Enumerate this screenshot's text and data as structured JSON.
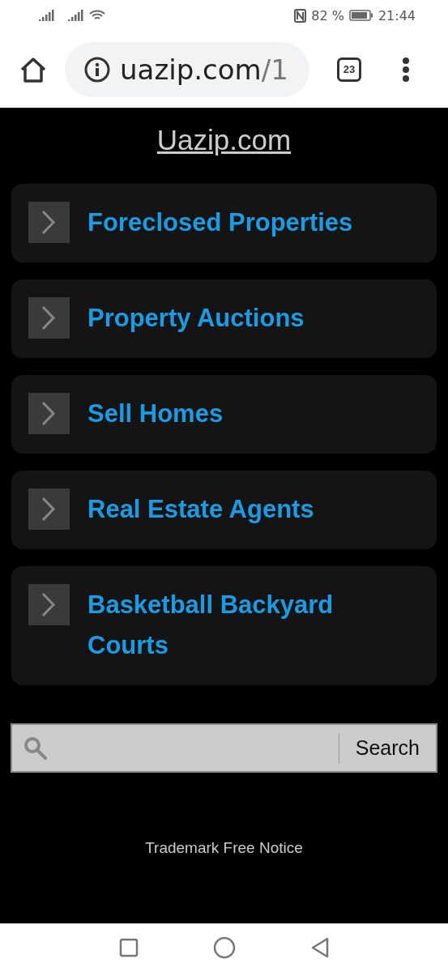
{
  "status_bar": {
    "battery": "82 %",
    "time": "21:44"
  },
  "browser": {
    "url_host": "uazip.com",
    "url_path": "/1",
    "tab_count": "23"
  },
  "site_title": "Uazip.com",
  "menu_items": [
    {
      "label": "Foreclosed Properties"
    },
    {
      "label": "Property Auctions"
    },
    {
      "label": "Sell Homes"
    },
    {
      "label": "Real Estate Agents"
    },
    {
      "label": "Basketball Backyard Courts"
    }
  ],
  "search": {
    "button": "Search"
  },
  "footer": "Trademark Free Notice"
}
